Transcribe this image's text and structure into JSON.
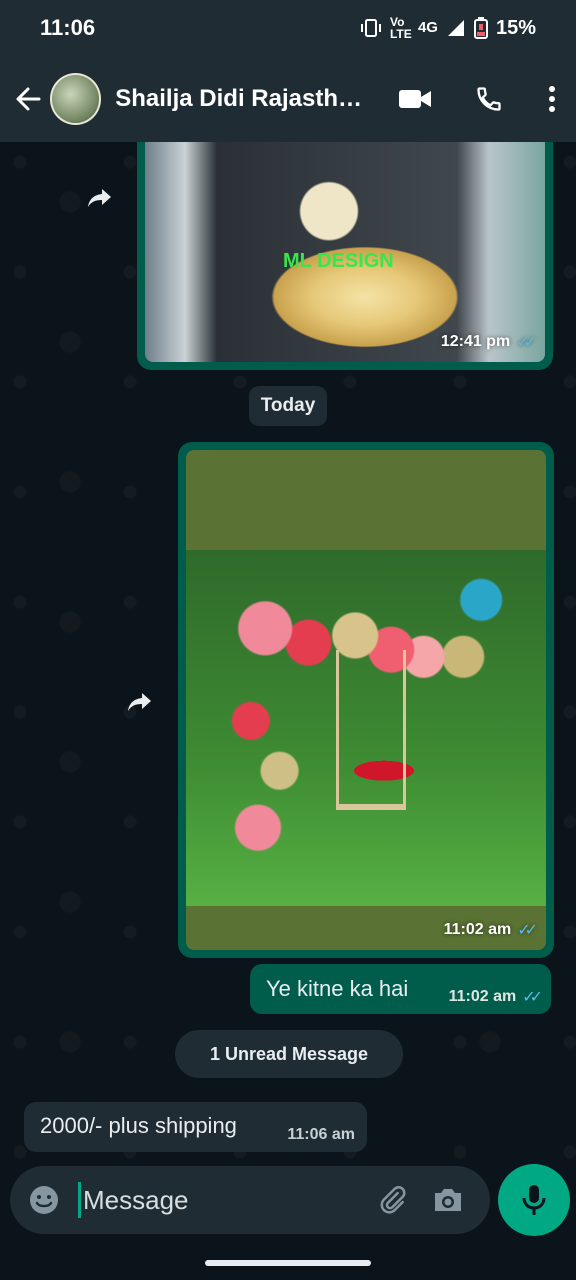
{
  "status_bar": {
    "time": "11:06",
    "network": "4G",
    "volte": "Vo LTE",
    "battery": "15%"
  },
  "header": {
    "title": "Shailja Didi Rajasth…"
  },
  "messages": [
    {
      "type": "image",
      "direction": "out",
      "watermark": "ML DESIGN",
      "time": "12:41 pm"
    },
    {
      "type": "date",
      "label": "Today"
    },
    {
      "type": "image",
      "direction": "out",
      "time": "11:02 am"
    },
    {
      "type": "text",
      "direction": "out",
      "text": "Ye kitne ka hai",
      "time": "11:02 am"
    },
    {
      "type": "divider",
      "label": "1 Unread Message"
    },
    {
      "type": "text",
      "direction": "in",
      "text": "2000/- plus shipping",
      "time": "11:06 am"
    }
  ],
  "composer": {
    "placeholder": "Message"
  },
  "colors": {
    "header_bg": "#1f2c34",
    "chat_bg": "#0b141a",
    "outgoing_bubble": "#005c4b",
    "incoming_bubble": "#1f2c34",
    "accent": "#00a884",
    "read_ticks": "#53bdeb"
  },
  "icons": [
    "back-arrow-icon",
    "video-call-icon",
    "phone-icon",
    "more-options-icon",
    "forward-icon",
    "emoji-icon",
    "attach-icon",
    "camera-icon",
    "mic-icon"
  ]
}
